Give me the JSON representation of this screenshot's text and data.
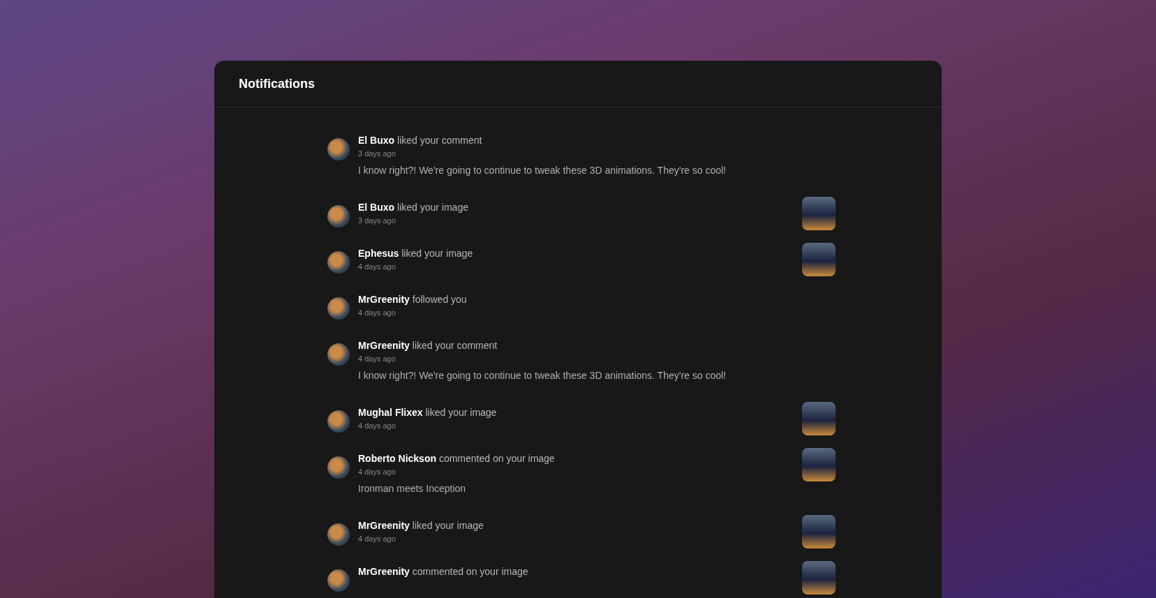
{
  "panel": {
    "title": "Notifications"
  },
  "notifications": [
    {
      "text": "**El Buxo** liked your comment",
      "time": "3 days ago",
      "comment": "I know right?! We're going to continue to tweak these 3D animations. They're so cool!",
      "has_image": false
    },
    {
      "text": "**El Buxo** liked your image",
      "time": "3 days ago",
      "has_image": true
    },
    {
      "text": "**Ephesus** liked your image",
      "time": "4 days ago",
      "has_image": true
    },
    {
      "text": "**MrGreenity** followed you",
      "time": "4 days ago",
      "has_image": false
    },
    {
      "text": "**MrGreenity** liked your comment",
      "time": "4 days ago",
      "comment": "I know right?! We're going to continue to tweak these 3D animations. They're so cool!",
      "has_image": false
    },
    {
      "text": "**Mughal Flixex** liked your image",
      "time": "4 days ago",
      "has_image": true
    },
    {
      "text": "**Roberto Nickson** commented on your image",
      "time": "4 days ago",
      "comment": "Ironman meets Inception",
      "has_image": true
    },
    {
      "text": "**MrGreenity** liked your image",
      "time": "4 days ago",
      "has_image": true
    },
    {
      "text": "**MrGreenity** commented on your image",
      "has_image": true
    }
  ]
}
